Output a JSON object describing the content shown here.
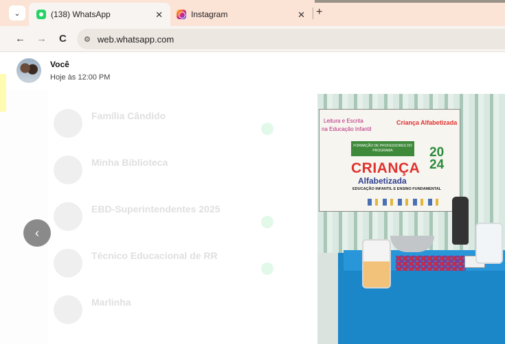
{
  "browser": {
    "tabs": [
      {
        "title": "(138) WhatsApp",
        "icon": "whatsapp-icon",
        "active": true
      },
      {
        "title": "Instagram",
        "icon": "instagram-icon",
        "active": false
      }
    ],
    "close_glyph": "✕",
    "new_tab_glyph": "+",
    "menu_glyph": "⌄",
    "url": "web.whatsapp.com",
    "nav": {
      "back": "←",
      "forward": "→",
      "reload": "C",
      "site_info": "⚙"
    }
  },
  "viewer": {
    "sender": "Você",
    "timestamp": "Hoje às 12:00 PM",
    "prev_glyph": "‹"
  },
  "background_chats": [
    "Família Cândido",
    "Minha Biblioteca",
    "EBD-Superintendentes 2025",
    "Técnico Educacional de RR",
    "Marlinha"
  ],
  "photo_banner": {
    "line1": "Leitura e Escrita",
    "line2": "na Educação Infantil",
    "program_name": "Criança Alfabetizada",
    "formation": "FORMAÇÃO DE PROFESSORES DO PROGRAMA",
    "crianca": "CRIANÇA",
    "year": "20 24",
    "alfabetizada": "Alfabetizada",
    "education": "EDUCAÇÃO INFANTIL E ENSINO FUNDAMENTAL"
  },
  "colors": {
    "tabbar": "#fbe3d6",
    "toolbar": "#f8f4f1",
    "whatsapp_green": "#25d366",
    "table_blue": "#1b86c8"
  }
}
